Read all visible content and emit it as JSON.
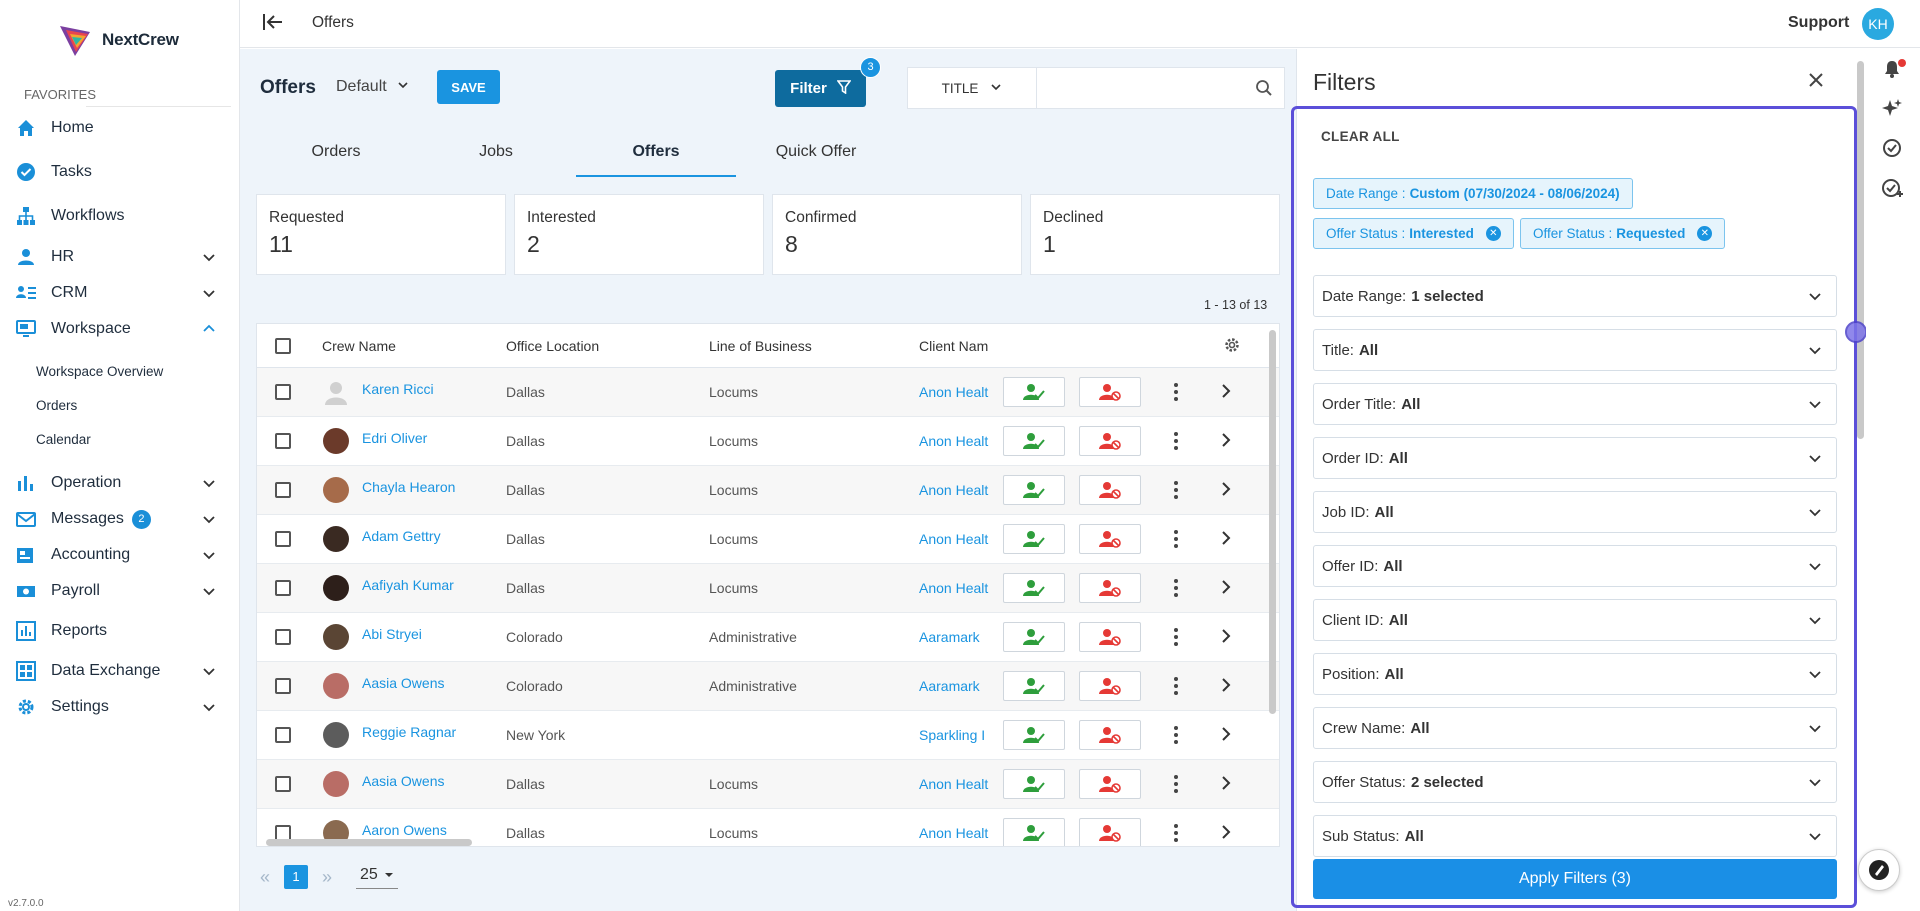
{
  "sidebar": {
    "logo_text": "NextCrew",
    "favorites_label": "FAVORITES",
    "items": [
      {
        "label": "Home",
        "icon": "home-icon"
      },
      {
        "label": "Tasks",
        "icon": "check-circle-icon"
      },
      {
        "label": "Workflows",
        "icon": "sitemap-icon"
      },
      {
        "label": "HR",
        "icon": "person-icon"
      },
      {
        "label": "CRM",
        "icon": "contacts-icon"
      },
      {
        "label": "Workspace",
        "icon": "monitor-icon"
      },
      {
        "label": "Operation",
        "icon": "bar-chart-icon"
      },
      {
        "label": "Messages",
        "icon": "mail-icon",
        "badge": "2"
      },
      {
        "label": "Accounting",
        "icon": "ledger-icon"
      },
      {
        "label": "Payroll",
        "icon": "money-icon"
      },
      {
        "label": "Reports",
        "icon": "report-icon"
      },
      {
        "label": "Data Exchange",
        "icon": "grid-icon"
      },
      {
        "label": "Settings",
        "icon": "gear-icon"
      }
    ],
    "workspace_sub": [
      "Workspace Overview",
      "Orders",
      "Calendar"
    ],
    "version": "v2.7.0.0"
  },
  "topbar": {
    "breadcrumb": "Offers",
    "support_label": "Support",
    "avatar_initials": "KH"
  },
  "main": {
    "title": "Offers",
    "view_select": "Default",
    "save_label": "SAVE",
    "filter_label": "Filter",
    "filter_count": "3",
    "search_field": "TITLE",
    "search_value": "",
    "tabs": [
      "Orders",
      "Jobs",
      "Offers",
      "Quick Offer"
    ],
    "active_tab": "Offers",
    "stats": [
      {
        "label": "Requested",
        "value": "11"
      },
      {
        "label": "Interested",
        "value": "2"
      },
      {
        "label": "Confirmed",
        "value": "8"
      },
      {
        "label": "Declined",
        "value": "1"
      }
    ],
    "range": "1 - 13 of 13",
    "columns": [
      "Crew Name",
      "Office Location",
      "Line of Business",
      "Client Nam"
    ],
    "rows": [
      {
        "name": "Karen Ricci",
        "location": "Dallas",
        "business": "Locums",
        "client": "Anon Healt"
      },
      {
        "name": "Edri Oliver",
        "location": "Dallas",
        "business": "Locums",
        "client": "Anon Healt"
      },
      {
        "name": "Chayla Hearon",
        "location": "Dallas",
        "business": "Locums",
        "client": "Anon Healt"
      },
      {
        "name": "Adam Gettry",
        "location": "Dallas",
        "business": "Locums",
        "client": "Anon Healt"
      },
      {
        "name": "Aafiyah Kumar",
        "location": "Dallas",
        "business": "Locums",
        "client": "Anon Healt"
      },
      {
        "name": "Abi Stryei",
        "location": "Colorado",
        "business": "Administrative",
        "client": "Aaramark"
      },
      {
        "name": "Aasia Owens",
        "location": "Colorado",
        "business": "Administrative",
        "client": "Aaramark"
      },
      {
        "name": "Reggie Ragnar",
        "location": "New York",
        "business": "",
        "client": "Sparkling I"
      },
      {
        "name": "Aasia Owens",
        "location": "Dallas",
        "business": "Locums",
        "client": "Anon Healt"
      },
      {
        "name": "Aaron Owens",
        "location": "Dallas",
        "business": "Locums",
        "client": "Anon Healt"
      }
    ],
    "pagination": {
      "page": "1",
      "per_page": "25"
    }
  },
  "filters": {
    "title": "Filters",
    "clear_all": "CLEAR ALL",
    "chips": [
      {
        "key": "Date Range :",
        "value": "Custom (07/30/2024 - 08/06/2024)",
        "removable": false
      },
      {
        "key": "Offer Status :",
        "value": "Interested",
        "removable": true
      },
      {
        "key": "Offer Status :",
        "value": "Requested",
        "removable": true
      }
    ],
    "rows": [
      {
        "label": "Date Range:",
        "value": "1 selected"
      },
      {
        "label": "Title:",
        "value": "All"
      },
      {
        "label": "Order Title:",
        "value": "All"
      },
      {
        "label": "Order ID:",
        "value": "All"
      },
      {
        "label": "Job ID:",
        "value": "All"
      },
      {
        "label": "Offer ID:",
        "value": "All"
      },
      {
        "label": "Client ID:",
        "value": "All"
      },
      {
        "label": "Position:",
        "value": "All"
      },
      {
        "label": "Crew Name:",
        "value": "All"
      },
      {
        "label": "Offer Status:",
        "value": "2 selected"
      },
      {
        "label": "Sub Status:",
        "value": "All"
      }
    ],
    "apply_label": "Apply Filters (3)"
  },
  "colors": {
    "accent": "#1a94e0",
    "filter_button": "#0e6b9e",
    "panel_outline": "#5b4fd9",
    "accept": "#2e9e3c",
    "reject": "#e53935"
  }
}
